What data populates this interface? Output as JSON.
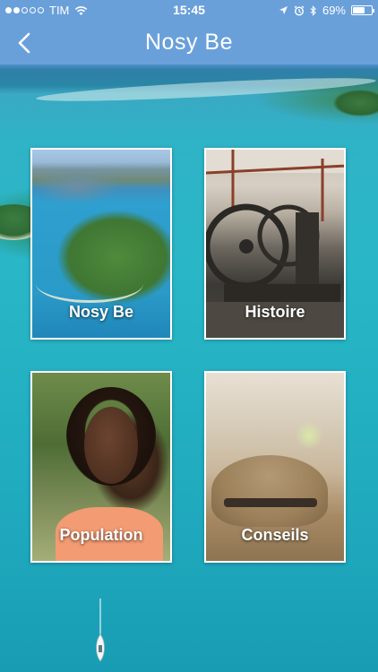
{
  "status_bar": {
    "carrier": "TIM",
    "time": "15:45",
    "battery_percent": "69%",
    "battery_level": 0.69,
    "signal_dots_full": 2,
    "signal_dots_total": 5
  },
  "nav": {
    "title": "Nosy Be",
    "back_icon": "chevron-left-icon"
  },
  "tiles": [
    {
      "label": "Nosy Be"
    },
    {
      "label": "Histoire"
    },
    {
      "label": "Population"
    },
    {
      "label": "Conseils"
    }
  ],
  "colors": {
    "nav_bar": "#6aa0da",
    "sea": "#23b0c2",
    "text": "#ffffff"
  }
}
